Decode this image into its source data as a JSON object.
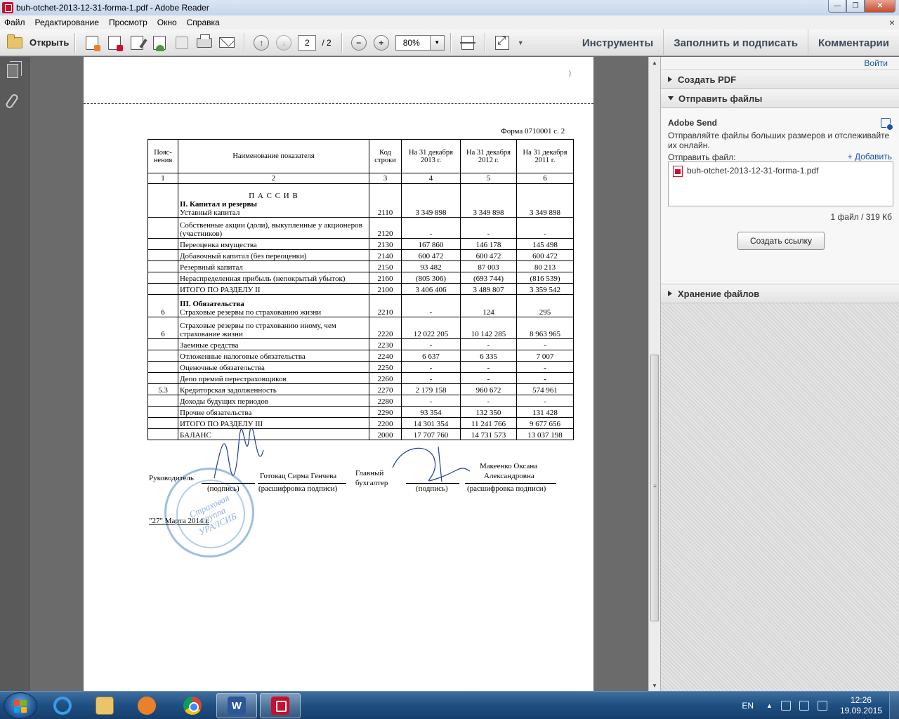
{
  "window": {
    "title": "buh-otchet-2013-12-31-forma-1.pdf - Adobe Reader"
  },
  "menu": {
    "items": [
      "Файл",
      "Редактирование",
      "Просмотр",
      "Окно",
      "Справка"
    ]
  },
  "toolbar": {
    "open_label": "Открыть",
    "page_current": "2",
    "page_total": "/ 2",
    "zoom_value": "80%",
    "tabs": [
      "Инструменты",
      "Заполнить и подписать",
      "Комментарии"
    ]
  },
  "document": {
    "form_label": "Форма  0710001 с. 2",
    "headers": {
      "col1": "Пояс-нения",
      "col2": "Наименование показателя",
      "col3": "Код строки",
      "col4": "На 31 декабря 2013 г.",
      "col5": "На 31 декабря 2012  г.",
      "col6": "На 31 декабря 2011  г."
    },
    "col_numbers": [
      "1",
      "2",
      "3",
      "4",
      "5",
      "6"
    ],
    "passiv_title": "П А С С И В",
    "section2_title": "II. Капитал и резервы",
    "section3_title": "III. Обязательства",
    "rows": [
      {
        "note": "",
        "name": "Уставный капитал",
        "code": "2110",
        "v2013": "3 349 898",
        "v2012": "3 349 898",
        "v2011": "3 349 898"
      },
      {
        "note": "",
        "name": "Собственные акции (доли), выкупленные у акционеров (участников)",
        "code": "2120",
        "v2013": "-",
        "v2012": "-",
        "v2011": "-"
      },
      {
        "note": "",
        "name": "Переоценка имущества",
        "code": "2130",
        "v2013": "167 860",
        "v2012": "146 178",
        "v2011": "145 498"
      },
      {
        "note": "",
        "name": "Добавочный капитал (без переоценки)",
        "code": "2140",
        "v2013": "600 472",
        "v2012": "600 472",
        "v2011": "600 472"
      },
      {
        "note": "",
        "name": "Резервный капитал",
        "code": "2150",
        "v2013": "93 482",
        "v2012": "87 003",
        "v2011": "80 213"
      },
      {
        "note": "",
        "name": "Нераспределенная прибыль (непокрытый убыток)",
        "code": "2160",
        "v2013": "(805 306)",
        "v2012": "(693 744)",
        "v2011": "(816 539)"
      },
      {
        "note": "",
        "name": "ИТОГО ПО РАЗДЕЛУ II",
        "code": "2100",
        "v2013": "3 406 406",
        "v2012": "3 489 807",
        "v2011": "3 359 542"
      },
      {
        "note": "6",
        "name": "Страховые резервы по страхованию жизни",
        "code": "2210",
        "v2013": "-",
        "v2012": "124",
        "v2011": "295"
      },
      {
        "note": "6",
        "name": "Страховые резервы по страхованию иному, чем страхование жизни",
        "code": "2220",
        "v2013": "12 022 205",
        "v2012": "10 142 285",
        "v2011": "8 963 965"
      },
      {
        "note": "",
        "name": "Заемные средства",
        "code": "2230",
        "v2013": "-",
        "v2012": "-",
        "v2011": "-"
      },
      {
        "note": "",
        "name": "Отложенные налоговые обязательства",
        "code": "2240",
        "v2013": "6 637",
        "v2012": "6 335",
        "v2011": "7 007"
      },
      {
        "note": "",
        "name": "Оценочные обязательства",
        "code": "2250",
        "v2013": "-",
        "v2012": "-",
        "v2011": "-"
      },
      {
        "note": "",
        "name": "Депо премий перестраховщиков",
        "code": "2260",
        "v2013": "-",
        "v2012": "-",
        "v2011": "-"
      },
      {
        "note": "5.3",
        "name": "Кредиторская задолженность",
        "code": "2270",
        "v2013": "2 179 158",
        "v2012": "960 672",
        "v2011": "574 961"
      },
      {
        "note": "",
        "name": "Доходы будущих периодов",
        "code": "2280",
        "v2013": "-",
        "v2012": "-",
        "v2011": "-"
      },
      {
        "note": "",
        "name": "Прочие обязательства",
        "code": "2290",
        "v2013": "93 354",
        "v2012": "132 350",
        "v2011": "131 428"
      },
      {
        "note": "",
        "name": "ИТОГО ПО РАЗДЕЛУ III",
        "code": "2200",
        "v2013": "14 301 354",
        "v2012": "11 241 766",
        "v2011": "9 677 656"
      },
      {
        "note": "",
        "name": "БАЛАНС",
        "code": "2000",
        "v2013": "17 707 760",
        "v2012": "14 731 573",
        "v2011": "13 037 198"
      }
    ],
    "signatures": {
      "head_label": "Руководитель",
      "head_name": "Готовац Сирма Генчева",
      "signature_caption": "(подпись)",
      "decoding_caption": "(расшифровка подписи)",
      "chief_accountant_label_1": "Главный",
      "chief_accountant_label_2": "бухгалтер",
      "accountant_name_1": "Макеенко Оксана",
      "accountant_name_2": "Александровна",
      "date": "\"27\" Марта 2014 г.",
      "stamp_text": "Страховая группа УРАЛСИБ"
    }
  },
  "right_pane": {
    "top_link": "Войти",
    "create_pdf": "Создать PDF",
    "send_files": "Отправить файлы",
    "send_title": "Adobe Send",
    "send_desc": "Отправляйте файлы больших размеров и отслеживайте их онлайн.",
    "send_file_label": "Отправить файл:",
    "add_label": "+ Добавить",
    "file_name": "buh-otchet-2013-12-31-forma-1.pdf",
    "file_count": "1 файл / 319 Кб",
    "create_link_button": "Создать ссылку",
    "storage": "Хранение файлов"
  },
  "taskbar": {
    "language": "EN",
    "time": "12:26",
    "date": "19.09.2015"
  }
}
